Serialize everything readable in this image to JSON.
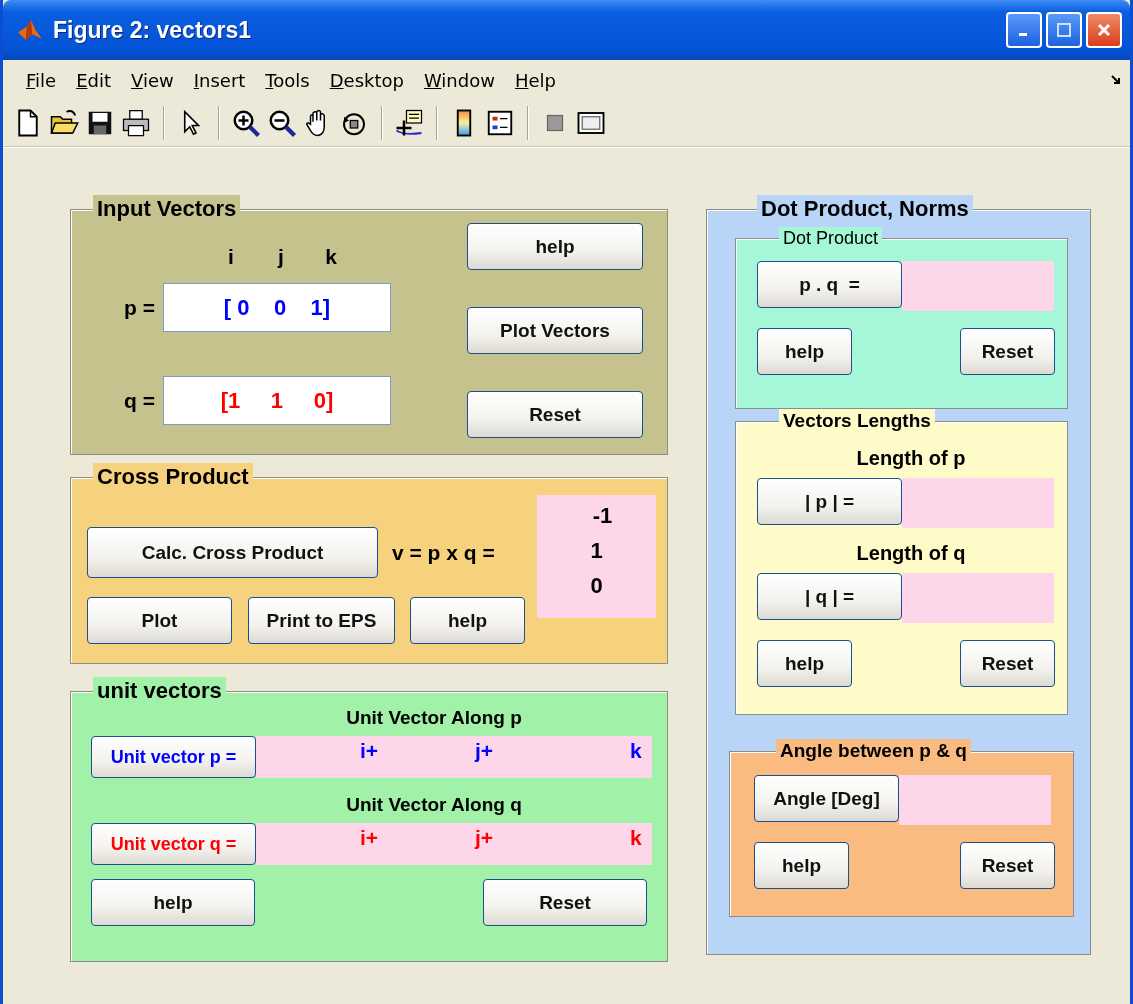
{
  "window": {
    "title": "Figure 2: vectors1"
  },
  "menu": [
    "File",
    "Edit",
    "View",
    "Insert",
    "Tools",
    "Desktop",
    "Window",
    "Help"
  ],
  "input_vectors": {
    "title": "Input Vectors",
    "column_headers": [
      "i",
      "j",
      "k"
    ],
    "vectors": [
      {
        "label": "p =",
        "value": "[ 0    0    1]",
        "color": "#0000ff"
      },
      {
        "label": "q =",
        "value": "[1     1     0]",
        "color": "#ff0000"
      }
    ],
    "buttons": [
      "help",
      "Plot Vectors",
      "Reset"
    ]
  },
  "cross_product": {
    "title": "Cross Product",
    "calc_button": "Calc. Cross Product",
    "equation": "v = p x q =",
    "result": [
      "-1",
      "1",
      "0"
    ],
    "buttons": [
      "Plot",
      "Print to EPS",
      "help"
    ]
  },
  "unit_vectors": {
    "title": "unit vectors",
    "rows": [
      {
        "heading": "Unit Vector Along p",
        "button": "Unit vector p =",
        "color": "#0000ff",
        "components": [
          "i+",
          "j+",
          "k"
        ]
      },
      {
        "heading": "Unit Vector Along q",
        "button": "Unit vector q =",
        "color": "#ff0000",
        "components": [
          "i+",
          "j+",
          "k"
        ]
      }
    ],
    "buttons": [
      "help",
      "Reset"
    ]
  },
  "dot_product_norms": {
    "title": "Dot Product, Norms",
    "dot_product": {
      "title": "Dot Product",
      "button": "p . q  =",
      "buttons": [
        "help",
        "Reset"
      ]
    },
    "vector_lengths": {
      "title": "Vectors Lengths",
      "rows": [
        {
          "heading": "Length of p",
          "button": "| p | ="
        },
        {
          "heading": "Length of q",
          "button": "| q | ="
        }
      ],
      "buttons": [
        "help",
        "Reset"
      ]
    },
    "angle": {
      "title": "Angle between p & q",
      "button": "Angle [Deg]",
      "buttons": [
        "help",
        "Reset"
      ]
    }
  }
}
